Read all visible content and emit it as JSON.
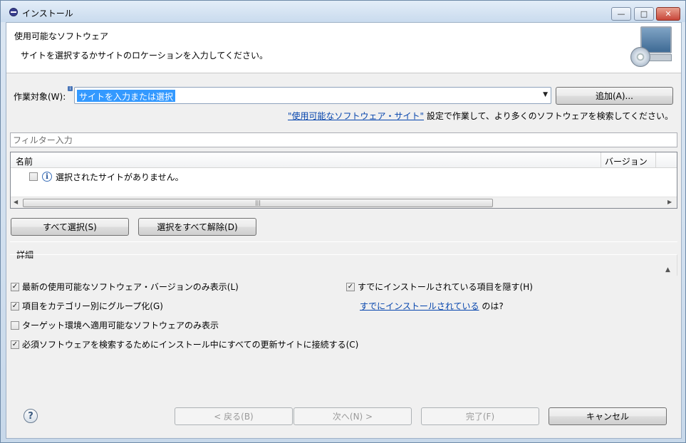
{
  "window": {
    "title": "インストール",
    "controls": {
      "minimize": "—",
      "maximize": "□",
      "close": "✕"
    }
  },
  "header": {
    "title": "使用可能なソフトウェア",
    "description": "サイトを選択するかサイトのロケーションを入力してください。",
    "icon": "software-install-monitor-icon"
  },
  "work_with": {
    "label": "作業対象(W):",
    "value": "サイトを入力または選択",
    "add_button": "追加(A)...",
    "hint_link": "\"使用可能なソフトウェア・サイト\"",
    "hint_text": " 設定で作業して、より多くのソフトウェアを検索してください。"
  },
  "filter": {
    "placeholder": "フィルター入力"
  },
  "tree": {
    "columns": [
      "名前",
      "バージョン"
    ],
    "rows": [
      {
        "text": "選択されたサイトがありません。",
        "checked": false,
        "icon": "info-icon"
      }
    ]
  },
  "selection_buttons": {
    "select_all": "すべて選択(S)",
    "deselect_all": "選択をすべて解除(D)"
  },
  "details": {
    "title": "詳細"
  },
  "options": {
    "latest_only": {
      "label": "最新の使用可能なソフトウェア・バージョンのみ表示(L)",
      "checked": true
    },
    "group_by_category": {
      "label": "項目をカテゴリー別にグループ化(G)",
      "checked": true
    },
    "target_env_only": {
      "label": "ターゲット環境へ適用可能なソフトウェアのみ表示",
      "checked": false
    },
    "contact_all_sites": {
      "label": "必須ソフトウェアを検索するためにインストール中にすべての更新サイトに接続する(C)",
      "checked": true
    },
    "hide_installed": {
      "label": "すでにインストールされている項目を隠す(H)",
      "checked": true
    },
    "already_installed_link": "すでにインストールされている",
    "already_installed_suffix": " のは?"
  },
  "footer": {
    "back": "< 戻る(B)",
    "next": "次へ(N) >",
    "finish": "完了(F)",
    "cancel": "キャンセル"
  },
  "check_mark": "✓"
}
